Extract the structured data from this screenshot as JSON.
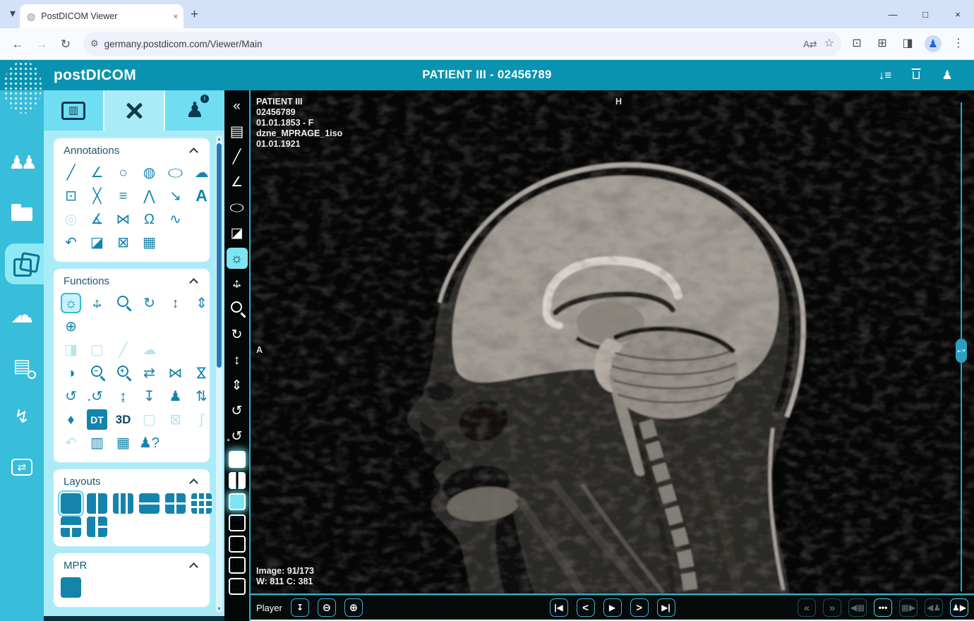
{
  "browser": {
    "tab_title": "PostDICOM Viewer",
    "url": "germany.postdicom.com/Viewer/Main",
    "tabstrip_icons": [
      {
        "name": "tab-search-icon",
        "g": "▾"
      }
    ],
    "tab_icons": [
      {
        "name": "tab-favicon",
        "g": "◍",
        "cls": "fav",
        "inter": false
      }
    ],
    "tab_close": [
      {
        "name": "tab-close-icon",
        "g": "×",
        "cls": "xs"
      }
    ],
    "new_tab": [
      {
        "name": "new-tab-icon",
        "g": "+",
        "cls": "plus"
      }
    ],
    "win_icons": [
      {
        "name": "minimize-icon",
        "g": "—",
        "cls": "win"
      },
      {
        "name": "maximize-icon",
        "g": "□",
        "cls": "win"
      },
      {
        "name": "close-icon",
        "g": "×",
        "cls": "win"
      }
    ],
    "nav_icons": [
      {
        "name": "back-icon",
        "g": "←"
      },
      {
        "name": "forward-icon",
        "g": "→",
        "cls": "dis"
      },
      {
        "name": "reload-icon",
        "g": "↻"
      }
    ],
    "pill_left": [
      {
        "name": "site-settings-icon",
        "g": "⚙",
        "cls": "sm"
      }
    ],
    "pill_right": [
      {
        "name": "translate-icon",
        "g": "A⇄",
        "cls": "sm"
      },
      {
        "name": "bookmark-star-icon",
        "g": "☆"
      }
    ],
    "right_icons": [
      {
        "name": "screen-capture-icon",
        "g": "⊡"
      },
      {
        "name": "extensions-icon",
        "g": "⊞"
      },
      {
        "name": "side-panel-icon",
        "g": "◨"
      },
      {
        "name": "profile-avatar-icon",
        "g": "♟",
        "cls": "avatar"
      },
      {
        "name": "menu-kebab-icon",
        "g": "⋮"
      }
    ]
  },
  "header": {
    "brand": "postDICOM",
    "title": "PATIENT III - 02456789",
    "icons": [
      {
        "name": "auto-sort-icon",
        "g": "↓≡"
      },
      {
        "name": "trash-icon",
        "g": "⊔",
        "cls": "trash"
      },
      {
        "name": "account-icon",
        "g": "♟"
      }
    ]
  },
  "sidebar": {
    "items": [
      {
        "name": "patients-icon",
        "g": "♟♟",
        "cls": "pawns"
      },
      {
        "name": "folder-icon",
        "cls": "folder"
      },
      {
        "name": "studies-icon",
        "cls": "stack"
      },
      {
        "name": "cloud-upload-icon",
        "g": "☁",
        "cls": "cloudup"
      },
      {
        "name": "worklist-search-icon",
        "g": "▤",
        "cls": "wsearch"
      },
      {
        "name": "quick-sync-icon",
        "g": "↯"
      },
      {
        "name": "transfer-icon",
        "g": "⇄",
        "cls": "boxed"
      }
    ]
  },
  "panel_tabs": {
    "t1": [
      {
        "name": "tab-viewer-settings-icon",
        "g": "▥",
        "cls": "boxed2"
      }
    ],
    "t2": [
      {
        "name": "tab-tools-icon",
        "cls": "xtools"
      }
    ],
    "t3": [
      {
        "name": "tab-patient-info-icon",
        "g": "♟",
        "cls": "pinfo"
      }
    ]
  },
  "annotations": {
    "title": "Annotations",
    "r1": [
      {
        "name": "ruler-icon",
        "g": "╱"
      },
      {
        "name": "angle-icon",
        "g": "∠"
      },
      {
        "name": "circle-icon",
        "g": "○"
      },
      {
        "name": "shaded-circle-icon",
        "g": "◍"
      },
      {
        "name": "ellipse-icon",
        "g": "◯",
        "cls": "squish"
      },
      {
        "name": "freehand-icon",
        "g": "☁"
      }
    ],
    "r2": [
      {
        "name": "rectangle-icon",
        "g": "⊡"
      },
      {
        "name": "cross-measure-icon",
        "g": "╳"
      },
      {
        "name": "parallel-lines-icon",
        "g": "≡"
      },
      {
        "name": "polyline-icon",
        "g": "⋀"
      },
      {
        "name": "arrow-icon",
        "g": "↘"
      },
      {
        "name": "text-icon",
        "g": "A",
        "cls": "bA"
      }
    ],
    "r3": [
      {
        "name": "calibration-target-icon",
        "g": "◎",
        "cls": "dim"
      },
      {
        "name": "open-angle-icon",
        "g": "∡"
      },
      {
        "name": "cobb-angle-icon",
        "g": "⋈"
      },
      {
        "name": "closed-region-icon",
        "g": "Ω"
      },
      {
        "name": "spline-icon",
        "g": "∿"
      }
    ],
    "r4": [
      {
        "name": "undo-icon",
        "g": "↶"
      },
      {
        "name": "eraser-icon",
        "g": "◪"
      },
      {
        "name": "erase-all-icon",
        "g": "⊠"
      },
      {
        "name": "save-annotations-icon",
        "g": "▦"
      }
    ]
  },
  "functions": {
    "title": "Functions",
    "r1": [
      {
        "name": "window-level-icon",
        "g": "☼",
        "cls": "chip"
      },
      {
        "name": "pan-icon",
        "cls": "pan"
      },
      {
        "name": "magnify-icon",
        "cls": "lens"
      },
      {
        "name": "rotate-icon",
        "g": "↻"
      },
      {
        "name": "scroll-icon",
        "g": "↕"
      },
      {
        "name": "stack-scroll-icon",
        "g": "⇕"
      }
    ],
    "r2": [
      {
        "name": "localizer-icon",
        "g": "⊕"
      }
    ],
    "r3": [
      {
        "name": "histogram-window-icon",
        "g": "◨",
        "cls": "dim"
      },
      {
        "name": "roi-window-icon",
        "g": "▢",
        "cls": "dim"
      },
      {
        "name": "probe-icon",
        "g": "╱",
        "cls": "dim"
      },
      {
        "name": "freehand-window-icon",
        "g": "☁",
        "cls": "dim"
      }
    ],
    "r4": [
      {
        "name": "invert-icon",
        "g": "◑"
      },
      {
        "name": "zoom-out-icon",
        "g": "−",
        "cls": "lens"
      },
      {
        "name": "zoom-in-icon",
        "g": "+",
        "cls": "lens"
      },
      {
        "name": "page-flip-icon",
        "g": "⇄"
      },
      {
        "name": "flip-horizontal-icon",
        "g": "⋈"
      },
      {
        "name": "flip-vertical-icon",
        "g": "⋈",
        "cls": "rot90"
      }
    ],
    "r5": [
      {
        "name": "reset-icon",
        "g": "↺"
      },
      {
        "name": "reset-window-icon",
        "g": "↺",
        "cls": "spark"
      },
      {
        "name": "expand-vertical-icon",
        "g": "↨"
      },
      {
        "name": "collapse-vertical-icon",
        "g": "↧"
      },
      {
        "name": "patient-orientation-icon",
        "g": "♟"
      },
      {
        "name": "sort-direction-icon",
        "g": "⇅"
      }
    ],
    "r6": [
      {
        "name": "tag-icon",
        "g": "♦"
      },
      {
        "name": "dt-icon",
        "g": "DT",
        "cls": "chipfill"
      },
      {
        "name": "threed-icon",
        "g": "3D",
        "cls": "b3d"
      },
      {
        "name": "selection-box-icon",
        "g": "▢",
        "cls": "dim"
      },
      {
        "name": "crop-box-icon",
        "g": "⊠",
        "cls": "dim"
      },
      {
        "name": "probe-rotate-icon",
        "g": "∫",
        "cls": "dim"
      }
    ],
    "r7": [
      {
        "name": "undo-region-icon",
        "g": "↶",
        "cls": "dim"
      },
      {
        "name": "export-image-icon",
        "g": "▥"
      },
      {
        "name": "save-image-icon",
        "g": "▦"
      },
      {
        "name": "patient-query-icon",
        "g": "♟?"
      }
    ]
  },
  "layouts": {
    "title": "Layouts",
    "r1": [
      {
        "name": "layout-1x1-icon",
        "cls": "lay sel"
      },
      {
        "name": "layout-2col-icon",
        "cls": "lay l2c"
      },
      {
        "name": "layout-3col-icon",
        "cls": "lay l3c"
      },
      {
        "name": "layout-2row-icon",
        "cls": "lay l2r"
      },
      {
        "name": "layout-2x2-icon",
        "cls": "lay l22"
      },
      {
        "name": "layout-3x3-icon",
        "cls": "lay l33"
      }
    ],
    "r2": [
      {
        "name": "layout-top2-icon",
        "cls": "lay lt2"
      },
      {
        "name": "layout-left2-icon",
        "cls": "lay ll2"
      }
    ]
  },
  "mpr": {
    "title": "MPR",
    "r1": [
      {
        "name": "mpr-layout-icon",
        "cls": "lay"
      }
    ]
  },
  "vtool": {
    "icons": [
      {
        "name": "collapse-panel-icon",
        "g": "«"
      },
      {
        "name": "report-icon",
        "g": "▤",
        "cls": "doc"
      },
      {
        "name": "ruler-icon",
        "g": "╱"
      },
      {
        "name": "angle-icon",
        "g": "∠"
      },
      {
        "name": "ellipse-icon",
        "g": "◯",
        "cls": "squish"
      },
      {
        "name": "eraser-icon",
        "g": "◪"
      },
      {
        "name": "window-level-icon",
        "g": "☼",
        "cls": "vchip"
      },
      {
        "name": "pan-icon",
        "cls": "pan"
      },
      {
        "name": "magnify-icon",
        "cls": "lens"
      },
      {
        "name": "rotate-icon",
        "g": "↻"
      },
      {
        "name": "scroll-icon",
        "g": "↕"
      },
      {
        "name": "stack-scroll-icon",
        "g": "⇕"
      },
      {
        "name": "reset-icon",
        "g": "↺"
      },
      {
        "name": "reset-window-icon",
        "g": "↺",
        "cls": "spark"
      },
      {
        "name": "layout-1x1-active-icon",
        "cls": "lay glow"
      },
      {
        "name": "layout-2col-icon",
        "cls": "lay l2c"
      },
      {
        "name": "layout-1x1-alt-icon",
        "cls": "lay glow cyanfill"
      },
      {
        "name": "layout-top2-icon",
        "cls": "lay lt2 outline"
      },
      {
        "name": "layout-left2-icon",
        "cls": "lay ll2 outline"
      },
      {
        "name": "layout-3col-icon",
        "cls": "lay l3c outline"
      },
      {
        "name": "layout-2row-icon",
        "cls": "lay l2r outline"
      }
    ]
  },
  "viewer": {
    "overlay_lines": [
      "PATIENT III",
      "02456789",
      "01.01.1853 - F",
      "dzne_MPRAGE_1iso",
      "01.01.1921"
    ],
    "orientation_top": "H",
    "orientation_left": "A",
    "image_index": "Image: 91/173",
    "window_level": "W: 811 C: 381",
    "slider": [
      {
        "name": "slice-slider-thumb",
        "g": "▴○▾",
        "cls": "vthumb"
      }
    ]
  },
  "player": {
    "label": "Player",
    "left": [
      {
        "name": "cine-export-icon",
        "g": "↧"
      },
      {
        "name": "speed-down-icon",
        "g": "⊖",
        "cls": "big"
      },
      {
        "name": "speed-up-icon",
        "g": "⊕",
        "cls": "big"
      }
    ],
    "center": [
      {
        "name": "first-image-icon",
        "g": "|◀"
      },
      {
        "name": "previous-image-icon",
        "g": "<",
        "cls": "big"
      },
      {
        "name": "play-icon",
        "g": "▶"
      },
      {
        "name": "next-image-icon",
        "g": ">",
        "cls": "big"
      },
      {
        "name": "last-image-icon",
        "g": "▶|"
      }
    ],
    "right": [
      {
        "name": "previous-series-icon",
        "g": "«",
        "cls": "dimbtn big"
      },
      {
        "name": "next-series-icon",
        "g": "»",
        "cls": "dimbtn big"
      },
      {
        "name": "previous-layout-icon",
        "g": "◀▦",
        "cls": "dimbtn"
      },
      {
        "name": "series-options-icon",
        "g": "•••",
        "cls": "onbtn"
      },
      {
        "name": "next-layout-icon",
        "g": "▦▶",
        "cls": "dimbtn"
      },
      {
        "name": "previous-patient-icon",
        "g": "◀♟",
        "cls": "dimbtn"
      },
      {
        "name": "next-patient-icon",
        "g": "♟▶",
        "cls": "onbtn"
      }
    ]
  }
}
